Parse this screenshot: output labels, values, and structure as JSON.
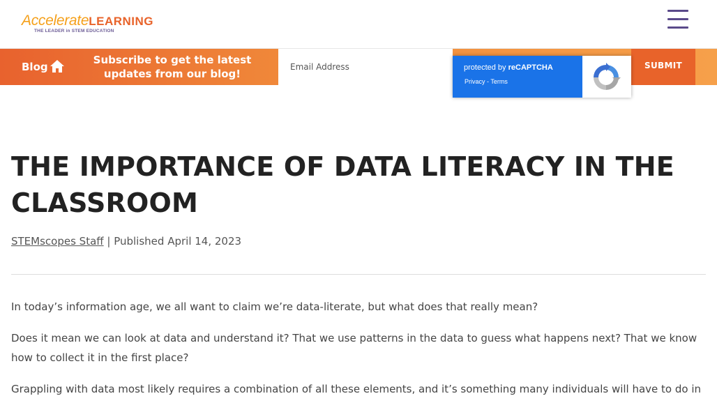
{
  "header": {
    "logo_primary": "Accelerate",
    "logo_secondary": "LEARNING",
    "logo_tagline": "THE LEADER in STEM EDUCATION",
    "menu_icon": "hamburger-menu-icon"
  },
  "subscribe_bar": {
    "blog_label": "Blog",
    "home_icon": "home-icon",
    "text": "Subscribe to get the latest updates from our blog!",
    "email_placeholder": "Email Address",
    "submit_label": "SUBMIT"
  },
  "recaptcha": {
    "protected_by": "protected by",
    "brand": "reCAPTCHA",
    "privacy": "Privacy",
    "separator": " - ",
    "terms": "Terms"
  },
  "article": {
    "title": "THE IMPORTANCE OF DATA LITERACY IN THE CLASSROOM",
    "author": "STEMscopes Staff",
    "separator": " | ",
    "published_label": "Published",
    "date": "April 14, 2023",
    "paragraphs": [
      "In today’s information age, we all want to claim we’re data-literate, but what does that really mean?",
      "Does it mean we can look at data and understand it? That we use patterns in the data to guess what happens next? That we know how to collect it in the first place?",
      "Grappling with data most likely requires a combination of all these elements, and it’s something many individuals will have to do in"
    ]
  },
  "colors": {
    "orange": "#e8632a",
    "gradient_end": "#f6a04a",
    "recaptcha_blue": "#1a73e8",
    "menu_purple": "#5a4a8a"
  }
}
